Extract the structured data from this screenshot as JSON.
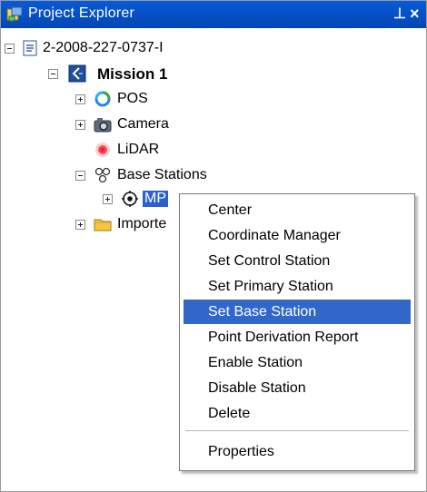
{
  "window": {
    "title": "Project Explorer",
    "pin_glyph": "⊥",
    "close_glyph": "×",
    "title_icon": "project-explorer-icon",
    "accent": "#0a5ad6"
  },
  "tree": {
    "nodes": [
      {
        "label": "2-2008-227-0737-I",
        "icon": "project-file-icon",
        "expander": "minus"
      },
      {
        "label": "Mission 1",
        "icon": "mission-icon",
        "expander": "minus"
      },
      {
        "label": "POS",
        "icon": "pos-icon",
        "expander": "plus"
      },
      {
        "label": "Camera",
        "icon": "camera-icon",
        "expander": "plus"
      },
      {
        "label": "LiDAR",
        "icon": "lidar-icon",
        "expander": "none"
      },
      {
        "label": "Base Stations",
        "icon": "base-stations-icon",
        "expander": "minus"
      },
      {
        "label": "MP",
        "icon": "station-target-icon",
        "expander": "plus"
      },
      {
        "label": "Importe",
        "icon": "folder-icon",
        "expander": "plus"
      }
    ]
  },
  "context_menu": {
    "items": [
      "Center",
      "Coordinate Manager",
      "Set Control Station",
      "Set Primary Station",
      "Set Base Station",
      "Point Derivation Report",
      "Enable Station",
      "Disable Station",
      "Delete",
      "Properties"
    ],
    "highlighted": "Set Base Station",
    "highlight_color": "#3167c9"
  }
}
